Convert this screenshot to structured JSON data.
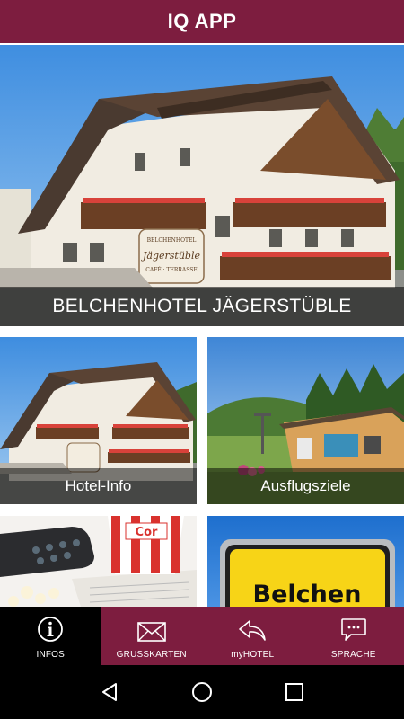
{
  "app": {
    "title": "IQ APP"
  },
  "hero": {
    "caption": "BELCHENHOTEL JÄGERSTÜBLE"
  },
  "tiles": [
    {
      "caption": "Hotel-Info"
    },
    {
      "caption": "Ausflugsziele"
    },
    {
      "caption": ""
    },
    {
      "caption": ""
    }
  ],
  "images": {
    "hotel_sign_lines": [
      "BELCHENHOTEL",
      "Jägerstüble",
      "CAFÉ · TERRASSE"
    ],
    "popcorn_box_text": "Cor",
    "belchen_sign_text": "Belchen"
  },
  "bottom_nav": [
    {
      "label": "INFOS",
      "icon": "info-icon",
      "active": true
    },
    {
      "label": "GRUSSKARTEN",
      "icon": "envelope-icon",
      "active": false
    },
    {
      "label": "myHOTEL",
      "icon": "reply-arrow-icon",
      "active": false
    },
    {
      "label": "SPRACHE",
      "icon": "chat-bubble-icon",
      "active": false
    }
  ],
  "colors": {
    "brand": "#7d1d3f",
    "active_tab": "#000000"
  }
}
